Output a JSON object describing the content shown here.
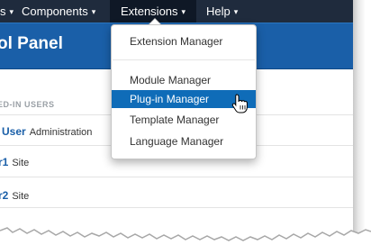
{
  "nav": {
    "items": [
      {
        "label": "s",
        "caret": "▾"
      },
      {
        "label": "Components",
        "caret": "▾"
      },
      {
        "label": "Extensions",
        "caret": "▾"
      },
      {
        "label": "Help",
        "caret": "▾"
      }
    ]
  },
  "header": {
    "title": "ol Panel"
  },
  "content": {
    "section_heading": "ED-IN USERS",
    "users": [
      {
        "name": "User",
        "role": "Administration"
      },
      {
        "name": "r1",
        "role": "Site"
      },
      {
        "name": "r2",
        "role": "Site"
      }
    ]
  },
  "dropdown": {
    "items": [
      {
        "label": "Extension Manager"
      },
      {
        "label": "Module Manager"
      },
      {
        "label": "Plug-in Manager"
      },
      {
        "label": "Template Manager"
      },
      {
        "label": "Language Manager"
      }
    ]
  },
  "colors": {
    "nav_bg": "#1f2b3d",
    "header_bg": "#1a5fa8",
    "accent": "#0f6cb8"
  }
}
